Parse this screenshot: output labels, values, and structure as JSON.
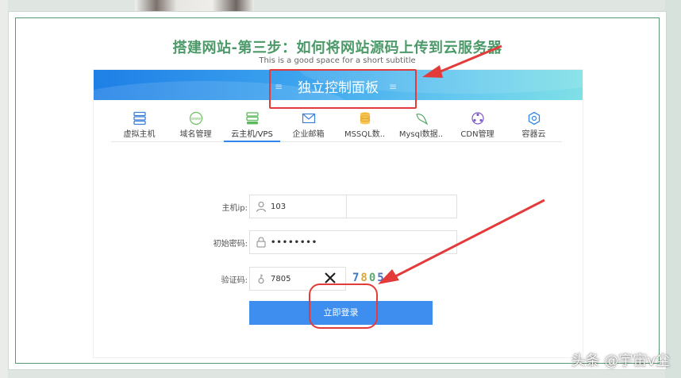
{
  "slide": {
    "title": "搭建网站-第三步：如何将网站源码上传到云服务器",
    "subtitle": "This is a good space for a short subtitle"
  },
  "panel": {
    "title": "独立控制面板"
  },
  "nav": {
    "items": [
      {
        "label": "虚拟主机",
        "icon": "server-icon"
      },
      {
        "label": "域名管理",
        "icon": "www-icon"
      },
      {
        "label": "云主机/VPS",
        "icon": "cloud-server-icon",
        "active": true
      },
      {
        "label": "企业邮箱",
        "icon": "mail-icon"
      },
      {
        "label": "MSSQL数..",
        "icon": "database-icon"
      },
      {
        "label": "Mysql数据..",
        "icon": "dolphin-icon"
      },
      {
        "label": "CDN管理",
        "icon": "cdn-icon"
      },
      {
        "label": "容器云",
        "icon": "container-icon"
      }
    ]
  },
  "form": {
    "host_ip_label": "主机ip:",
    "host_ip_value": "103",
    "password_label": "初始密码:",
    "password_value": "••••••••",
    "captcha_label": "验证码:",
    "captcha_value": "7805",
    "captcha_image_text": "7805",
    "login_label": "立即登录"
  },
  "watermark": "头条 @宇宙v尘",
  "colors": {
    "title_green": "#4c9a69",
    "frame_green": "#5a9a72",
    "header_blue": "#1e7fe6",
    "button_blue": "#3e8ef0",
    "annotation_red": "#e33a3a"
  }
}
